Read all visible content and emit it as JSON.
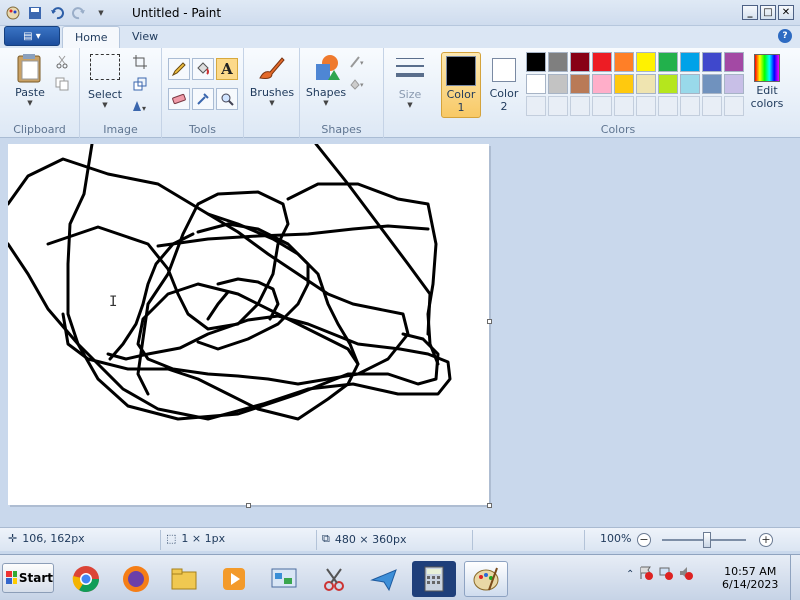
{
  "window": {
    "title": "Untitled - Paint"
  },
  "tabs": {
    "home": "Home",
    "view": "View"
  },
  "clipboard": {
    "paste": "Paste",
    "group_label": "Clipboard"
  },
  "image": {
    "select": "Select",
    "group_label": "Image"
  },
  "tools": {
    "group_label": "Tools"
  },
  "brushes": {
    "label": "Brushes"
  },
  "shapes": {
    "label": "Shapes",
    "group_label": "Shapes"
  },
  "size": {
    "label": "Size"
  },
  "colors": {
    "color1_label": "Color",
    "color1_num": "1",
    "color2_label": "Color",
    "color2_num": "2",
    "edit_label": "Edit",
    "edit_label2": "colors",
    "group_label": "Colors",
    "color1": "#000000",
    "color2": "#ffffff",
    "palette": [
      "#000000",
      "#7f7f7f",
      "#880015",
      "#ed1c24",
      "#ff7f27",
      "#fff200",
      "#22b14c",
      "#00a2e8",
      "#3f48cc",
      "#a349a4",
      "#ffffff",
      "#c3c3c3",
      "#b97a57",
      "#ffaec9",
      "#ffc90e",
      "#efe4b0",
      "#b5e61d",
      "#99d9ea",
      "#7092be",
      "#c8bfe7"
    ]
  },
  "status": {
    "cursor_pos": "106, 162px",
    "selection_size": "1 × 1px",
    "image_size": "480 × 360px",
    "zoom": "100%",
    "zoom_minus": "−",
    "zoom_plus": "+"
  },
  "taskbar": {
    "start": "Start",
    "apps": [
      "chrome-icon",
      "firefox-icon",
      "file-explorer-icon",
      "media-player-icon",
      "control-panel-icon",
      "snipping-tool-icon",
      "send-icon",
      "calculator-icon",
      "paint-icon"
    ],
    "time": "10:57 AM",
    "date": "6/14/2023"
  }
}
